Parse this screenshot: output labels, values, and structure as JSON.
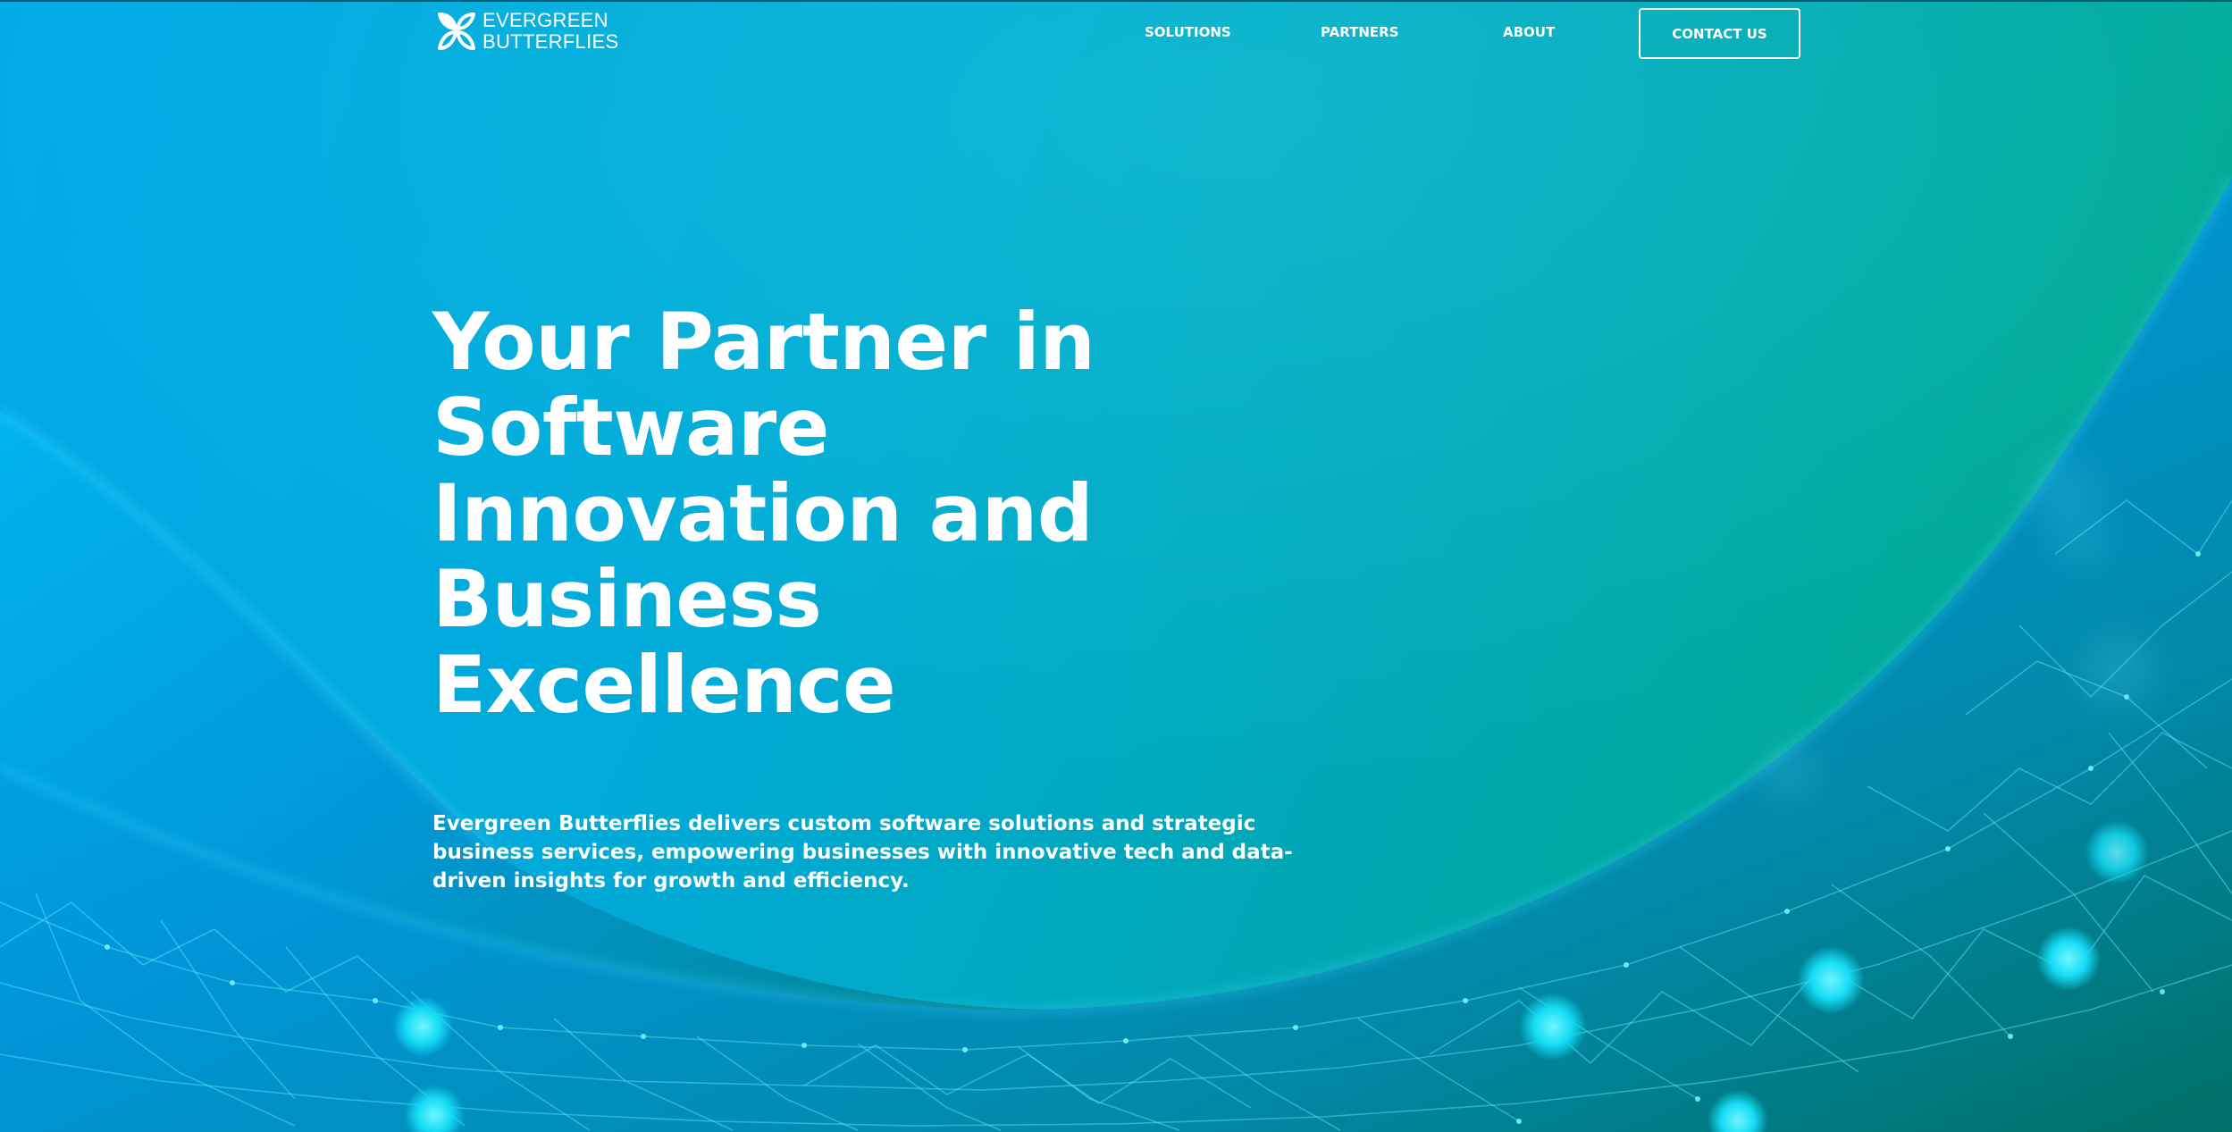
{
  "brand": {
    "name_line1": "EVERGREEN",
    "name_line2": "BUTTERFLIES",
    "logo_icon": "butterfly-logo-icon"
  },
  "nav": {
    "items": [
      {
        "label": "SOLUTIONS"
      },
      {
        "label": "PARTNERS"
      },
      {
        "label": "ABOUT"
      }
    ],
    "cta_label": "CONTACT US"
  },
  "hero": {
    "title_lines": [
      "Your Partner in",
      "Software",
      "Innovation and",
      "Business",
      "Excellence"
    ],
    "description": "Evergreen Butterflies delivers custom software solutions and strategic business services, empowering businesses with innovative tech and data-driven insights for growth and efficiency."
  },
  "theme": {
    "accent_blue": "#00a9e8",
    "accent_teal": "#00a88f",
    "network_glow": "#38e6ff",
    "text": "#ffffff"
  }
}
